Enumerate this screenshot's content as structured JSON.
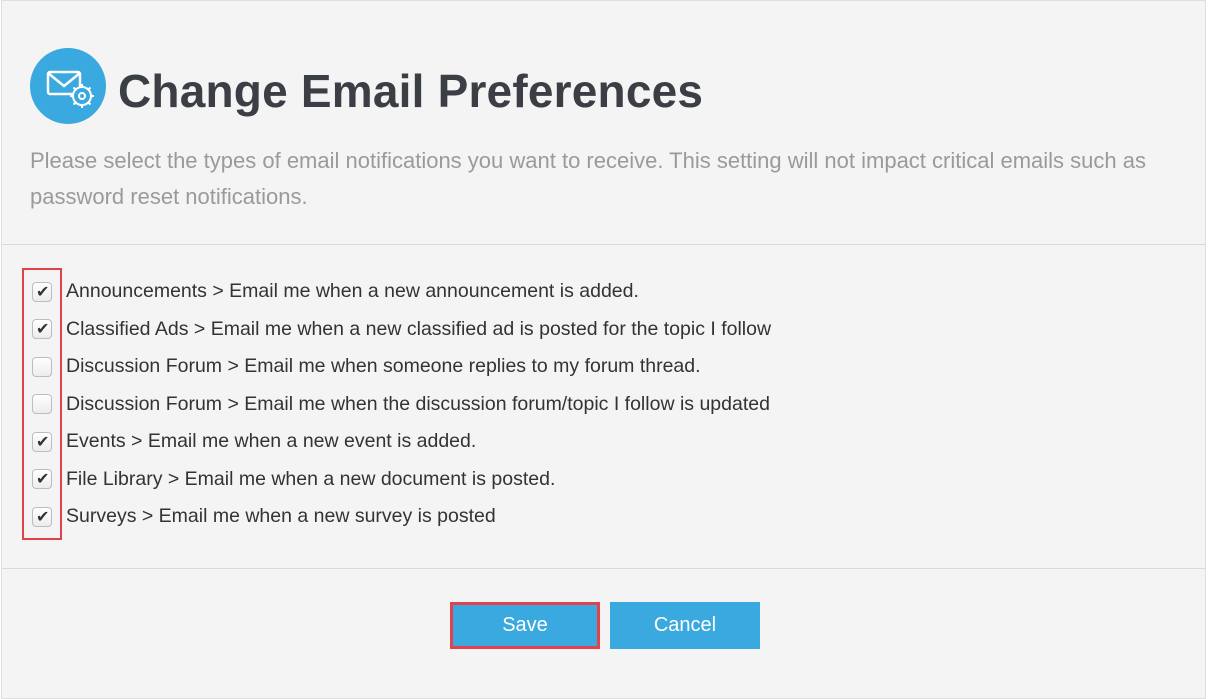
{
  "header": {
    "icon": "email-settings-icon",
    "title": "Change Email Preferences",
    "description": "Please select the types of email notifications you want to receive. This setting will not impact critical emails such as password reset notifications."
  },
  "preferences": [
    {
      "label": "Announcements > Email me when a new announcement is added.",
      "checked": true
    },
    {
      "label": "Classified Ads > Email me when a new classified ad is posted for the topic I follow",
      "checked": true
    },
    {
      "label": "Discussion Forum > Email me when someone replies to my forum thread.",
      "checked": false
    },
    {
      "label": "Discussion Forum > Email me when the discussion forum/topic I follow is updated",
      "checked": false
    },
    {
      "label": "Events > Email me when a new event is added.",
      "checked": true
    },
    {
      "label": "File Library > Email me when a new document is posted.",
      "checked": true
    },
    {
      "label": "Surveys > Email me when a new survey is posted",
      "checked": true
    }
  ],
  "actions": {
    "save_label": "Save",
    "cancel_label": "Cancel"
  },
  "colors": {
    "accent": "#3aa9df",
    "highlight": "#e0434b",
    "title": "#3b3e44",
    "description": "#9a9a9a"
  }
}
